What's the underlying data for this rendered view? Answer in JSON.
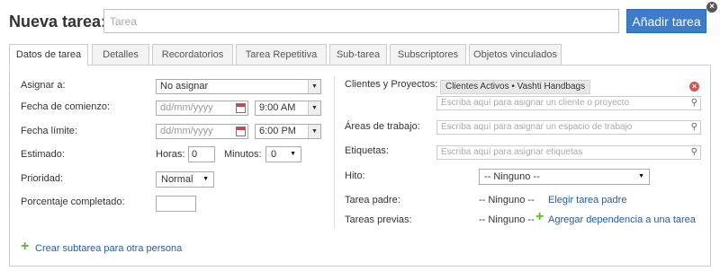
{
  "header": {
    "title": "Nueva tarea:",
    "task_placeholder": "Tarea",
    "add_button": "Añadir tarea"
  },
  "tabs": [
    {
      "label": "Datos de tarea",
      "active": true
    },
    {
      "label": "Detalles"
    },
    {
      "label": "Recordatorios"
    },
    {
      "label": "Tarea Repetitiva"
    },
    {
      "label": "Sub-tarea"
    },
    {
      "label": "Subscriptores"
    },
    {
      "label": "Objetos vinculados"
    }
  ],
  "left": {
    "assign": {
      "label": "Asignar a:",
      "value": "No asignar"
    },
    "start": {
      "label": "Fecha de comienzo:",
      "date_placeholder": "dd/mm/yyyy",
      "time": "9:00 AM"
    },
    "due": {
      "label": "Fecha límite:",
      "date_placeholder": "dd/mm/yyyy",
      "time": "6:00 PM"
    },
    "estimate": {
      "label": "Estimado:",
      "hours_label": "Horas:",
      "hours_value": "0",
      "minutes_label": "Minutos:",
      "minutes_value": "0"
    },
    "priority": {
      "label": "Prioridad:",
      "value": "Normal"
    },
    "percent": {
      "label": "Porcentaje completado:",
      "value": ""
    },
    "create_subtask": "Crear subtarea para otra persona"
  },
  "right": {
    "clients": {
      "label": "Clientes y Proyectos:",
      "tag": "Clientes Activos • Vashti Handbags",
      "placeholder": "Escriba aquí para asignar un cliente o proyecto"
    },
    "workspaces": {
      "label": "Áreas de trabajo:",
      "placeholder": "Escriba aquí para asignar un espacio de trabajo"
    },
    "tags": {
      "label": "Etiquetas:",
      "placeholder": "Escriba aquí para asignar etiquetas"
    },
    "milestone": {
      "label": "Hito:",
      "value": "-- Ninguno --"
    },
    "parent": {
      "label": "Tarea padre:",
      "value": "-- Ninguno --",
      "link": "Elegir tarea padre"
    },
    "previous": {
      "label": "Tareas previas:",
      "value": "-- Ninguno --",
      "link": "Agregar dependencia a una tarea"
    }
  },
  "colors": {
    "accent": "#3d7cc9",
    "link": "#1f5ea8",
    "plus": "#5cb82e",
    "remove": "#d9534f"
  }
}
